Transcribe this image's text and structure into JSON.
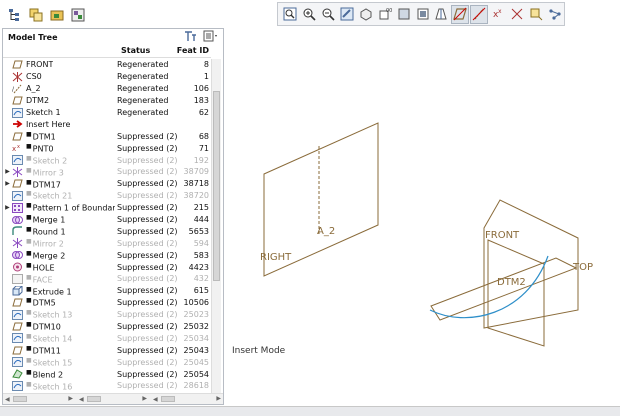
{
  "tree": {
    "title": "Model Tree",
    "columns": {
      "name": "",
      "status": "Status",
      "feat_id": "Feat ID"
    },
    "rows": [
      {
        "name": "FRONT",
        "status": "Regenerated",
        "id": "8",
        "icon": "datum-plane-icon",
        "state": "normal",
        "expand": ""
      },
      {
        "name": "CS0",
        "status": "Regenerated",
        "id": "1",
        "icon": "csys-icon",
        "state": "normal",
        "expand": ""
      },
      {
        "name": "A_2",
        "status": "Regenerated",
        "id": "106",
        "icon": "datum-axis-icon",
        "state": "normal",
        "expand": ""
      },
      {
        "name": "DTM2",
        "status": "Regenerated",
        "id": "183",
        "icon": "datum-plane-icon",
        "state": "normal",
        "expand": ""
      },
      {
        "name": "Sketch 1",
        "status": "Regenerated",
        "id": "62",
        "icon": "sketch-icon",
        "state": "normal",
        "expand": ""
      },
      {
        "name": "Insert Here",
        "status": "",
        "id": "",
        "icon": "insert-arrow-icon",
        "state": "insert",
        "expand": ""
      },
      {
        "name": "DTM1",
        "status": "Suppressed (2)",
        "id": "68",
        "icon": "datum-plane-icon",
        "state": "normal",
        "expand": ""
      },
      {
        "name": "PNT0",
        "status": "Suppressed (2)",
        "id": "71",
        "icon": "datum-point-icon",
        "state": "normal",
        "expand": ""
      },
      {
        "name": "Sketch 2",
        "status": "Suppressed (2)",
        "id": "192",
        "icon": "sketch-icon",
        "state": "dim",
        "expand": ""
      },
      {
        "name": "Mirror 3",
        "status": "Suppressed (2)",
        "id": "38709",
        "icon": "mirror-icon",
        "state": "dim",
        "expand": "▶"
      },
      {
        "name": "DTM17",
        "status": "Suppressed (2)",
        "id": "38718",
        "icon": "datum-plane-icon",
        "state": "normal",
        "expand": "▶"
      },
      {
        "name": "Sketch 21",
        "status": "Suppressed (2)",
        "id": "38720",
        "icon": "sketch-icon",
        "state": "dim",
        "expand": ""
      },
      {
        "name": "Pattern 1 of Boundar",
        "status": "Suppressed (2)",
        "id": "215",
        "icon": "pattern-icon",
        "state": "normal",
        "expand": "▶"
      },
      {
        "name": "Merge 1",
        "status": "Suppressed (2)",
        "id": "444",
        "icon": "merge-icon",
        "state": "normal",
        "expand": ""
      },
      {
        "name": "Round 1",
        "status": "Suppressed (2)",
        "id": "5653",
        "icon": "round-icon",
        "state": "normal",
        "expand": ""
      },
      {
        "name": "Mirror 2",
        "status": "Suppressed (2)",
        "id": "594",
        "icon": "mirror-icon",
        "state": "dim",
        "expand": ""
      },
      {
        "name": "Merge 2",
        "status": "Suppressed (2)",
        "id": "583",
        "icon": "merge-icon",
        "state": "normal",
        "expand": ""
      },
      {
        "name": "HOLE",
        "status": "Suppressed (2)",
        "id": "4423",
        "icon": "hole-icon",
        "state": "normal",
        "expand": ""
      },
      {
        "name": "FACE",
        "status": "Suppressed (2)",
        "id": "432",
        "icon": "face-icon",
        "state": "dim",
        "expand": ""
      },
      {
        "name": "Extrude 1",
        "status": "Suppressed (2)",
        "id": "615",
        "icon": "extrude-icon",
        "state": "normal",
        "expand": ""
      },
      {
        "name": "DTM5",
        "status": "Suppressed (2)",
        "id": "10506",
        "icon": "datum-plane-icon",
        "state": "normal",
        "expand": ""
      },
      {
        "name": "Sketch 13",
        "status": "Suppressed (2)",
        "id": "25023",
        "icon": "sketch-icon",
        "state": "dim",
        "expand": ""
      },
      {
        "name": "DTM10",
        "status": "Suppressed (2)",
        "id": "25032",
        "icon": "datum-plane-icon",
        "state": "normal",
        "expand": ""
      },
      {
        "name": "Sketch 14",
        "status": "Suppressed (2)",
        "id": "25034",
        "icon": "sketch-icon",
        "state": "dim",
        "expand": ""
      },
      {
        "name": "DTM11",
        "status": "Suppressed (2)",
        "id": "25043",
        "icon": "datum-plane-icon",
        "state": "normal",
        "expand": ""
      },
      {
        "name": "Sketch 15",
        "status": "Suppressed (2)",
        "id": "25045",
        "icon": "sketch-icon",
        "state": "dim",
        "expand": ""
      },
      {
        "name": "Blend 2",
        "status": "Suppressed (2)",
        "id": "25054",
        "icon": "blend-icon",
        "state": "normal",
        "expand": ""
      },
      {
        "name": "Sketch 16",
        "status": "Suppressed (2)",
        "id": "28618",
        "icon": "sketch-icon",
        "state": "dim",
        "expand": ""
      }
    ]
  },
  "viewport": {
    "labels": {
      "right": "RIGHT",
      "a2": "A_2",
      "front": "FRONT",
      "top": "TOP",
      "dtm2": "DTM2"
    },
    "status_text": "Insert Mode"
  },
  "toolbar_icons": {
    "top_left": [
      "tree-icon",
      "layers-icon",
      "folder-icon",
      "settings-icon"
    ],
    "graphics": [
      "refit-icon",
      "zoom-in-icon",
      "zoom-out-icon",
      "repaint-icon",
      "orientation-icon",
      "saved-views-icon",
      "display-style-icon",
      "view-manager-icon",
      "perspective-icon",
      "plane-display-icon",
      "axis-display-icon",
      "point-display-icon",
      "csys-display-icon",
      "annotation-display-icon",
      "spin-center-icon"
    ]
  },
  "colors": {
    "datum": "#8a6b3a",
    "curve": "#2e8fc9",
    "dim_text": "#b0b0b0"
  }
}
